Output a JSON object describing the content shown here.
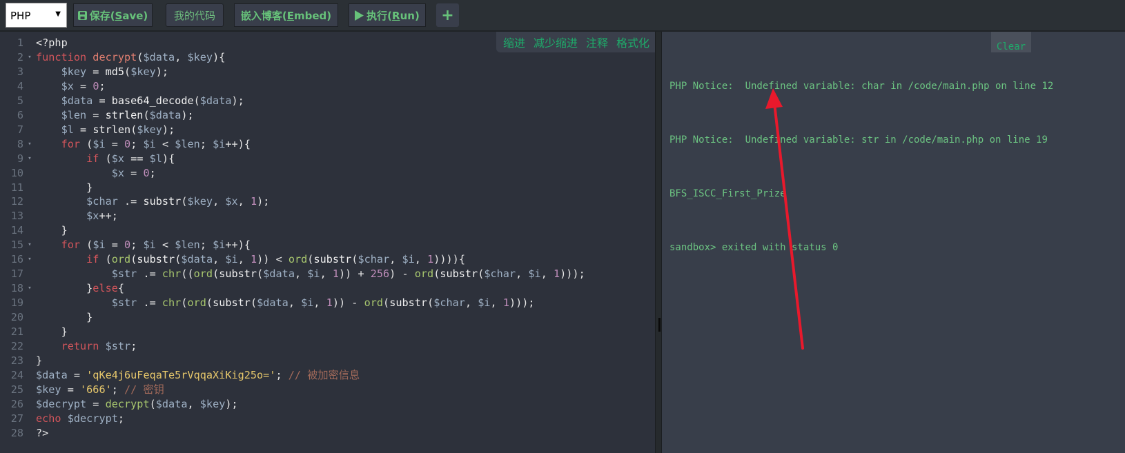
{
  "toolbar": {
    "language": "PHP",
    "save_label_pre": "保存(",
    "save_label_key": "S",
    "save_label_post": "ave)",
    "my_code_label": "我的代码",
    "embed_label_pre": "嵌入博客(",
    "embed_label_key": "E",
    "embed_label_post": "mbed)",
    "run_label_pre": "执行(",
    "run_label_key": "R",
    "run_label_post": "un)",
    "add_label": "+"
  },
  "editor_tools": [
    "缩进",
    "减少缩进",
    "注释",
    "格式化"
  ],
  "code_lines": [
    {
      "n": "1",
      "fold": "",
      "t": [
        [
          "pu",
          "<?php"
        ]
      ]
    },
    {
      "n": "2",
      "fold": "▾",
      "t": [
        [
          "kw",
          "function "
        ],
        [
          "fn",
          "decrypt"
        ],
        [
          "pu",
          "("
        ],
        [
          "v",
          "$data"
        ],
        [
          "pu",
          ", "
        ],
        [
          "v",
          "$key"
        ],
        [
          "pu",
          "){"
        ]
      ]
    },
    {
      "n": "3",
      "fold": "",
      "t": [
        [
          "pu",
          "    "
        ],
        [
          "v",
          "$key"
        ],
        [
          "pu",
          " = "
        ],
        [
          "bi",
          "md5"
        ],
        [
          "pu",
          "("
        ],
        [
          "v",
          "$key"
        ],
        [
          "pu",
          ");"
        ]
      ]
    },
    {
      "n": "4",
      "fold": "",
      "t": [
        [
          "pu",
          "    "
        ],
        [
          "v",
          "$x"
        ],
        [
          "pu",
          " = "
        ],
        [
          "num",
          "0"
        ],
        [
          "pu",
          ";"
        ]
      ]
    },
    {
      "n": "5",
      "fold": "",
      "t": [
        [
          "pu",
          "    "
        ],
        [
          "v",
          "$data"
        ],
        [
          "pu",
          " = "
        ],
        [
          "bi",
          "base64_decode"
        ],
        [
          "pu",
          "("
        ],
        [
          "v",
          "$data"
        ],
        [
          "pu",
          ");"
        ]
      ]
    },
    {
      "n": "6",
      "fold": "",
      "t": [
        [
          "pu",
          "    "
        ],
        [
          "v",
          "$len"
        ],
        [
          "pu",
          " = "
        ],
        [
          "bi",
          "strlen"
        ],
        [
          "pu",
          "("
        ],
        [
          "v",
          "$data"
        ],
        [
          "pu",
          ");"
        ]
      ]
    },
    {
      "n": "7",
      "fold": "",
      "t": [
        [
          "pu",
          "    "
        ],
        [
          "v",
          "$l"
        ],
        [
          "pu",
          " = "
        ],
        [
          "bi",
          "strlen"
        ],
        [
          "pu",
          "("
        ],
        [
          "v",
          "$key"
        ],
        [
          "pu",
          ");"
        ]
      ]
    },
    {
      "n": "8",
      "fold": "▾",
      "t": [
        [
          "pu",
          "    "
        ],
        [
          "kw",
          "for"
        ],
        [
          "pu",
          " ("
        ],
        [
          "v",
          "$i"
        ],
        [
          "pu",
          " = "
        ],
        [
          "num",
          "0"
        ],
        [
          "pu",
          "; "
        ],
        [
          "v",
          "$i"
        ],
        [
          "pu",
          " < "
        ],
        [
          "v",
          "$len"
        ],
        [
          "pu",
          "; "
        ],
        [
          "v",
          "$i"
        ],
        [
          "pu",
          "++){"
        ]
      ]
    },
    {
      "n": "9",
      "fold": "▾",
      "t": [
        [
          "pu",
          "        "
        ],
        [
          "kw",
          "if"
        ],
        [
          "pu",
          " ("
        ],
        [
          "v",
          "$x"
        ],
        [
          "pu",
          " == "
        ],
        [
          "v",
          "$l"
        ],
        [
          "pu",
          "){"
        ]
      ]
    },
    {
      "n": "10",
      "fold": "",
      "t": [
        [
          "pu",
          "            "
        ],
        [
          "v",
          "$x"
        ],
        [
          "pu",
          " = "
        ],
        [
          "num",
          "0"
        ],
        [
          "pu",
          ";"
        ]
      ]
    },
    {
      "n": "11",
      "fold": "",
      "t": [
        [
          "pu",
          "        }"
        ]
      ]
    },
    {
      "n": "12",
      "fold": "",
      "t": [
        [
          "pu",
          "        "
        ],
        [
          "v",
          "$char"
        ],
        [
          "pu",
          " .= "
        ],
        [
          "bi",
          "substr"
        ],
        [
          "pu",
          "("
        ],
        [
          "v",
          "$key"
        ],
        [
          "pu",
          ", "
        ],
        [
          "v",
          "$x"
        ],
        [
          "pu",
          ", "
        ],
        [
          "num",
          "1"
        ],
        [
          "pu",
          ");"
        ]
      ]
    },
    {
      "n": "13",
      "fold": "",
      "t": [
        [
          "pu",
          "        "
        ],
        [
          "v",
          "$x"
        ],
        [
          "pu",
          "++;"
        ]
      ]
    },
    {
      "n": "14",
      "fold": "",
      "t": [
        [
          "pu",
          "    }"
        ]
      ]
    },
    {
      "n": "15",
      "fold": "▾",
      "t": [
        [
          "pu",
          "    "
        ],
        [
          "kw",
          "for"
        ],
        [
          "pu",
          " ("
        ],
        [
          "v",
          "$i"
        ],
        [
          "pu",
          " = "
        ],
        [
          "num",
          "0"
        ],
        [
          "pu",
          "; "
        ],
        [
          "v",
          "$i"
        ],
        [
          "pu",
          " < "
        ],
        [
          "v",
          "$len"
        ],
        [
          "pu",
          "; "
        ],
        [
          "v",
          "$i"
        ],
        [
          "pu",
          "++){"
        ]
      ]
    },
    {
      "n": "16",
      "fold": "▾",
      "t": [
        [
          "pu",
          "        "
        ],
        [
          "kw",
          "if"
        ],
        [
          "pu",
          " ("
        ],
        [
          "gr",
          "ord"
        ],
        [
          "pu",
          "("
        ],
        [
          "bi",
          "substr"
        ],
        [
          "pu",
          "("
        ],
        [
          "v",
          "$data"
        ],
        [
          "pu",
          ", "
        ],
        [
          "v",
          "$i"
        ],
        [
          "pu",
          ", "
        ],
        [
          "num",
          "1"
        ],
        [
          "pu",
          ")) < "
        ],
        [
          "gr",
          "ord"
        ],
        [
          "pu",
          "("
        ],
        [
          "bi",
          "substr"
        ],
        [
          "pu",
          "("
        ],
        [
          "v",
          "$char"
        ],
        [
          "pu",
          ", "
        ],
        [
          "v",
          "$i"
        ],
        [
          "pu",
          ", "
        ],
        [
          "num",
          "1"
        ],
        [
          "pu",
          ")))){"
        ]
      ]
    },
    {
      "n": "17",
      "fold": "",
      "t": [
        [
          "pu",
          "            "
        ],
        [
          "v",
          "$str"
        ],
        [
          "pu",
          " .= "
        ],
        [
          "gr",
          "chr"
        ],
        [
          "pu",
          "(("
        ],
        [
          "gr",
          "ord"
        ],
        [
          "pu",
          "("
        ],
        [
          "bi",
          "substr"
        ],
        [
          "pu",
          "("
        ],
        [
          "v",
          "$data"
        ],
        [
          "pu",
          ", "
        ],
        [
          "v",
          "$i"
        ],
        [
          "pu",
          ", "
        ],
        [
          "num",
          "1"
        ],
        [
          "pu",
          ")) + "
        ],
        [
          "num",
          "256"
        ],
        [
          "pu",
          ") - "
        ],
        [
          "gr",
          "ord"
        ],
        [
          "pu",
          "("
        ],
        [
          "bi",
          "substr"
        ],
        [
          "pu",
          "("
        ],
        [
          "v",
          "$char"
        ],
        [
          "pu",
          ", "
        ],
        [
          "v",
          "$i"
        ],
        [
          "pu",
          ", "
        ],
        [
          "num",
          "1"
        ],
        [
          "pu",
          ")));"
        ]
      ]
    },
    {
      "n": "18",
      "fold": "▾",
      "t": [
        [
          "pu",
          "        }"
        ],
        [
          "kw",
          "else"
        ],
        [
          "pu",
          "{"
        ]
      ]
    },
    {
      "n": "19",
      "fold": "",
      "t": [
        [
          "pu",
          "            "
        ],
        [
          "v",
          "$str"
        ],
        [
          "pu",
          " .= "
        ],
        [
          "gr",
          "chr"
        ],
        [
          "pu",
          "("
        ],
        [
          "gr",
          "ord"
        ],
        [
          "pu",
          "("
        ],
        [
          "bi",
          "substr"
        ],
        [
          "pu",
          "("
        ],
        [
          "v",
          "$data"
        ],
        [
          "pu",
          ", "
        ],
        [
          "v",
          "$i"
        ],
        [
          "pu",
          ", "
        ],
        [
          "num",
          "1"
        ],
        [
          "pu",
          ")) - "
        ],
        [
          "gr",
          "ord"
        ],
        [
          "pu",
          "("
        ],
        [
          "bi",
          "substr"
        ],
        [
          "pu",
          "("
        ],
        [
          "v",
          "$char"
        ],
        [
          "pu",
          ", "
        ],
        [
          "v",
          "$i"
        ],
        [
          "pu",
          ", "
        ],
        [
          "num",
          "1"
        ],
        [
          "pu",
          ")));"
        ]
      ]
    },
    {
      "n": "20",
      "fold": "",
      "t": [
        [
          "pu",
          "        }"
        ]
      ]
    },
    {
      "n": "21",
      "fold": "",
      "t": [
        [
          "pu",
          "    }"
        ]
      ]
    },
    {
      "n": "22",
      "fold": "",
      "t": [
        [
          "pu",
          "    "
        ],
        [
          "kw",
          "return"
        ],
        [
          "pu",
          " "
        ],
        [
          "v",
          "$str"
        ],
        [
          "pu",
          ";"
        ]
      ]
    },
    {
      "n": "23",
      "fold": "",
      "t": [
        [
          "pu",
          "}"
        ]
      ]
    },
    {
      "n": "24",
      "fold": "",
      "t": [
        [
          "v",
          "$data"
        ],
        [
          "pu",
          " = "
        ],
        [
          "str",
          "'qKe4j6uFeqaTe5rVqqaXiKig25o='"
        ],
        [
          "pu",
          "; "
        ],
        [
          "cm",
          "// 被加密信息"
        ]
      ]
    },
    {
      "n": "25",
      "fold": "",
      "t": [
        [
          "v",
          "$key"
        ],
        [
          "pu",
          " = "
        ],
        [
          "str",
          "'666'"
        ],
        [
          "pu",
          "; "
        ],
        [
          "cm",
          "// 密钥"
        ]
      ]
    },
    {
      "n": "26",
      "fold": "",
      "t": [
        [
          "v",
          "$decrypt"
        ],
        [
          "pu",
          " = "
        ],
        [
          "gr",
          "decrypt"
        ],
        [
          "pu",
          "("
        ],
        [
          "v",
          "$data"
        ],
        [
          "pu",
          ", "
        ],
        [
          "v",
          "$key"
        ],
        [
          "pu",
          ");"
        ]
      ]
    },
    {
      "n": "27",
      "fold": "",
      "t": [
        [
          "kw",
          "echo"
        ],
        [
          "pu",
          " "
        ],
        [
          "v",
          "$decrypt"
        ],
        [
          "pu",
          ";"
        ]
      ]
    },
    {
      "n": "28",
      "fold": "",
      "t": [
        [
          "pu",
          "?>"
        ]
      ]
    }
  ],
  "output": {
    "clear_label": "Clear",
    "lines": [
      "PHP Notice:  Undefined variable: char in /code/main.php on line 12",
      "PHP Notice:  Undefined variable: str in /code/main.php on line 19",
      "BFS_ISCC_First_Prize",
      "sandbox> exited with status 0"
    ]
  },
  "annotation": {
    "arrow_color": "#e8192c"
  }
}
